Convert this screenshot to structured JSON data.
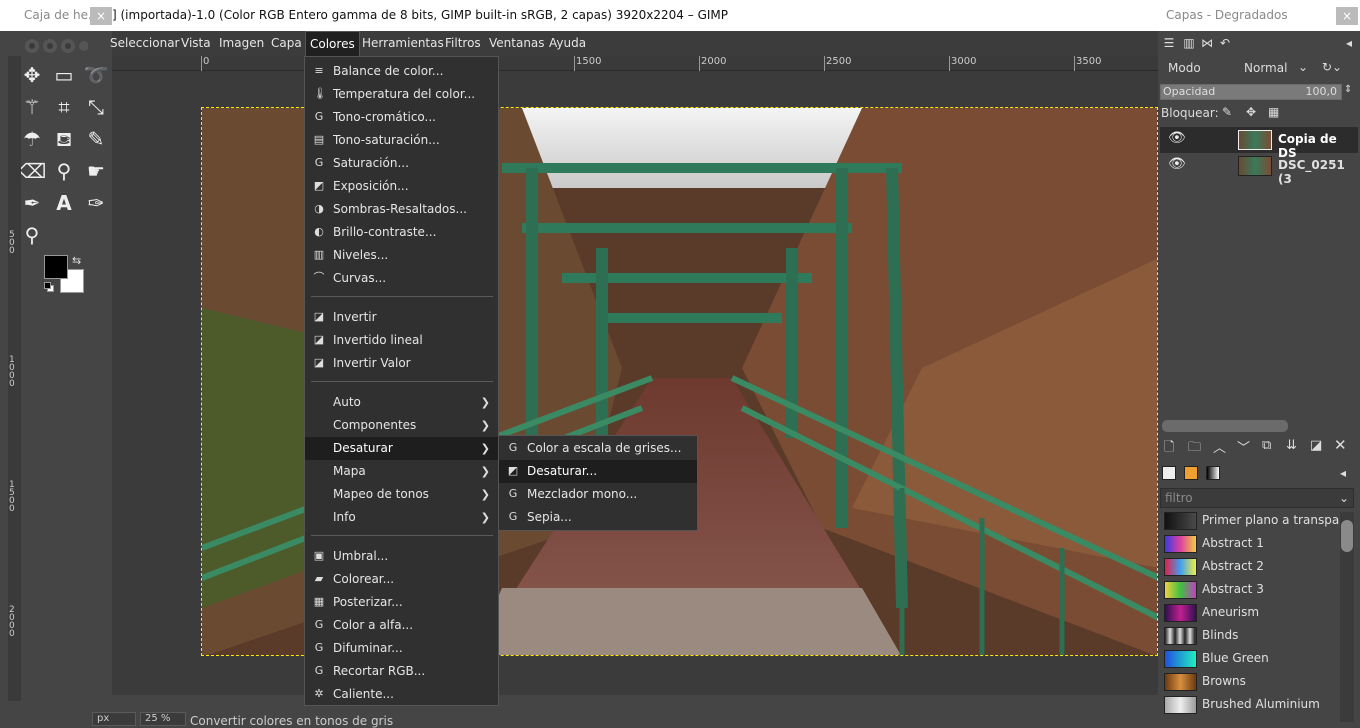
{
  "toolbox": {
    "title": "Caja de he...",
    "close_label": "×"
  },
  "image_window": {
    "title": "] (importada)-1.0 (Color RGB Entero gamma de 8 bits, GIMP built-in sRGB, 2 capas) 3920x2204 – GIMP",
    "close_label": "×"
  },
  "menubar": {
    "items": [
      "Seleccionar",
      "Vista",
      "Imagen",
      "Capa",
      "Colores",
      "Herramientas",
      "Filtros",
      "Ventanas",
      "Ayuda"
    ],
    "active": "Colores"
  },
  "ruler_top": {
    "labels": [
      "0",
      "1500",
      "2000",
      "2500",
      "3000",
      "3500"
    ]
  },
  "ruler_left": {
    "labels": [
      "500",
      "1000",
      "1500",
      "2000"
    ]
  },
  "colores_menu": {
    "items": [
      {
        "label": "Balance de color...",
        "icon": "balance-icon"
      },
      {
        "label": "Temperatura del color...",
        "icon": "thermometer-icon"
      },
      {
        "label": "Tono-cromático...",
        "icon": "gegl-icon"
      },
      {
        "label": "Tono-saturación...",
        "icon": "hue-icon"
      },
      {
        "label": "Saturación...",
        "icon": "gegl-icon"
      },
      {
        "label": "Exposición...",
        "icon": "exposure-icon"
      },
      {
        "label": "Sombras-Resaltados...",
        "icon": "shadows-icon"
      },
      {
        "label": "Brillo-contraste...",
        "icon": "contrast-icon"
      },
      {
        "label": "Niveles...",
        "icon": "levels-icon"
      },
      {
        "label": "Curvas...",
        "icon": "curves-icon"
      },
      {
        "label": "Invertir",
        "icon": "invert-icon"
      },
      {
        "label": "Invertido lineal",
        "icon": "invert-icon"
      },
      {
        "label": "Invertir Valor",
        "icon": "invert-icon"
      },
      {
        "label": "Auto",
        "submenu": true
      },
      {
        "label": "Componentes",
        "submenu": true
      },
      {
        "label": "Desaturar",
        "submenu": true
      },
      {
        "label": "Mapa",
        "submenu": true
      },
      {
        "label": "Mapeo de tonos",
        "submenu": true
      },
      {
        "label": "Info",
        "submenu": true
      },
      {
        "label": "Umbral...",
        "icon": "threshold-icon"
      },
      {
        "label": "Colorear...",
        "icon": "colorize-icon"
      },
      {
        "label": "Posterizar...",
        "icon": "posterize-icon"
      },
      {
        "label": "Color a alfa...",
        "icon": "gegl-icon"
      },
      {
        "label": "Difuminar...",
        "icon": "gegl-icon"
      },
      {
        "label": "Recortar RGB...",
        "icon": "gegl-icon"
      },
      {
        "label": "Caliente...",
        "icon": "gear-icon"
      }
    ],
    "highlighted": "Desaturar"
  },
  "desaturar_menu": {
    "items": [
      {
        "label": "Color a escala de grises...",
        "icon": "gegl-icon"
      },
      {
        "label": "Desaturar...",
        "icon": "desaturate-icon"
      },
      {
        "label": "Mezclador mono...",
        "icon": "gegl-icon"
      },
      {
        "label": "Sepia...",
        "icon": "gegl-icon"
      }
    ],
    "highlighted": "Desaturar..."
  },
  "dock": {
    "title": "Capas - Degradados",
    "close_label": "×",
    "mode_label": "Modo",
    "mode_value": "Normal",
    "opacity_label": "Opacidad",
    "opacity_value": "100,0",
    "opacity_fraction": 1.0,
    "lock_label": "Bloquear:",
    "layers": [
      {
        "name": "Copia de DS",
        "active": true
      },
      {
        "name": "DSC_0251 (3",
        "active": false
      }
    ],
    "filter_placeholder": "filtro",
    "gradients": [
      {
        "name": "Primer plano a transpar",
        "colors": [
          "#111111",
          "#4a4a4a"
        ]
      },
      {
        "name": "Abstract 1",
        "colors": [
          "#3a3ae0",
          "#e040a0",
          "#f0d040"
        ]
      },
      {
        "name": "Abstract 2",
        "colors": [
          "#e0204a",
          "#40a0f0",
          "#f0f040"
        ]
      },
      {
        "name": "Abstract 3",
        "colors": [
          "#f0d040",
          "#40c040",
          "#c040c0"
        ]
      },
      {
        "name": "Aneurism",
        "colors": [
          "#301050",
          "#c02090",
          "#301050"
        ]
      },
      {
        "name": "Blinds",
        "colors": [
          "#222222",
          "#dddddd",
          "#222222"
        ]
      },
      {
        "name": "Blue Green",
        "colors": [
          "#2050e0",
          "#20f0c0"
        ]
      },
      {
        "name": "Browns",
        "colors": [
          "#6a3a10",
          "#d89040",
          "#6a3a10"
        ]
      },
      {
        "name": "Brushed Aluminium",
        "colors": [
          "#aaaaaa",
          "#eeeeee",
          "#999999"
        ]
      }
    ]
  },
  "statusbar": {
    "unit": "px",
    "zoom": "25 %",
    "message": "Convertir colores en tonos de gris"
  }
}
